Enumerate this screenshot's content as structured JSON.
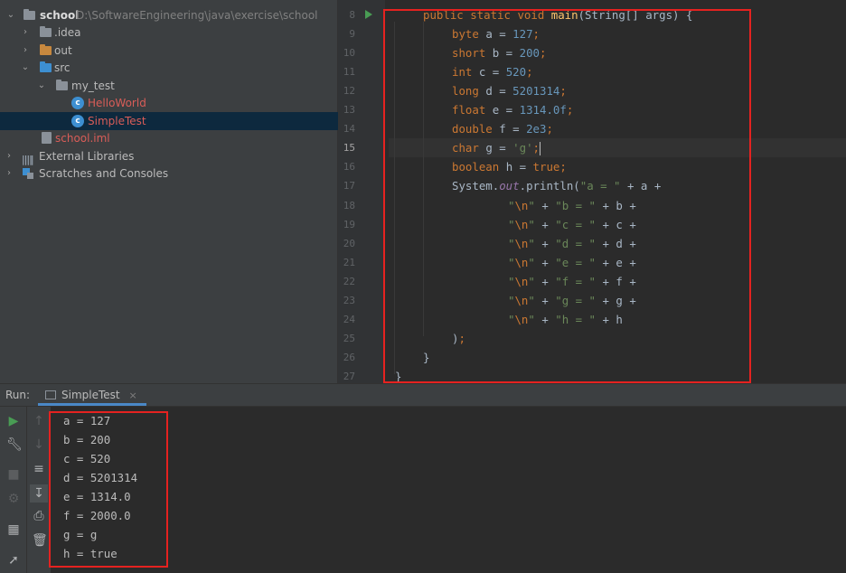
{
  "project_tree": {
    "root": {
      "name": "school",
      "path": "D:\\SoftwareEngineering\\java\\exercise\\school"
    },
    "items": [
      {
        "label": ".idea"
      },
      {
        "label": "out"
      },
      {
        "label": "src"
      },
      {
        "label": "my_test"
      },
      {
        "label": "HelloWorld"
      },
      {
        "label": "SimpleTest"
      },
      {
        "label": "school.iml"
      },
      {
        "label": "External Libraries"
      },
      {
        "label": "Scratches and Consoles"
      }
    ]
  },
  "editor": {
    "line_numbers": [
      "8",
      "9",
      "10",
      "11",
      "12",
      "13",
      "14",
      "15",
      "16",
      "17",
      "18",
      "19",
      "20",
      "21",
      "22",
      "23",
      "24",
      "25",
      "26",
      "27"
    ],
    "current_line": "15"
  },
  "code_lines": [
    [
      [
        "kw",
        "public "
      ],
      [
        "kw",
        "static "
      ],
      [
        "kw",
        "void "
      ],
      [
        "fn",
        "main"
      ],
      [
        "p",
        "(String[] args) {"
      ]
    ],
    [
      [
        "kw",
        "byte "
      ],
      [
        "p",
        "a = "
      ],
      [
        "num",
        "127"
      ],
      [
        "kw",
        ";"
      ]
    ],
    [
      [
        "kw",
        "short "
      ],
      [
        "p",
        "b = "
      ],
      [
        "num",
        "200"
      ],
      [
        "kw",
        ";"
      ]
    ],
    [
      [
        "kw",
        "int "
      ],
      [
        "p",
        "c = "
      ],
      [
        "num",
        "520"
      ],
      [
        "kw",
        ";"
      ]
    ],
    [
      [
        "kw",
        "long "
      ],
      [
        "p",
        "d = "
      ],
      [
        "num",
        "5201314"
      ],
      [
        "kw",
        ";"
      ]
    ],
    [
      [
        "kw",
        "float "
      ],
      [
        "p",
        "e = "
      ],
      [
        "num",
        "1314.0f"
      ],
      [
        "kw",
        ";"
      ]
    ],
    [
      [
        "kw",
        "double "
      ],
      [
        "p",
        "f = "
      ],
      [
        "num",
        "2e3"
      ],
      [
        "kw",
        ";"
      ]
    ],
    [
      [
        "kw",
        "char "
      ],
      [
        "p",
        "g = "
      ],
      [
        "str",
        "'g'"
      ],
      [
        "kw",
        ";"
      ]
    ],
    [
      [
        "kw",
        "boolean "
      ],
      [
        "p",
        "h = "
      ],
      [
        "kw",
        "true"
      ],
      [
        "kw",
        ";"
      ]
    ],
    [
      [
        "p",
        "System."
      ],
      [
        "sf",
        "out"
      ],
      [
        "p",
        ".println("
      ],
      [
        "str",
        "\"a = \""
      ],
      [
        "p",
        " + a +"
      ]
    ],
    [
      [
        "str",
        "\""
      ],
      [
        "esc",
        "\\n"
      ],
      [
        "str",
        "\""
      ],
      [
        "p",
        " + "
      ],
      [
        "str",
        "\"b = \""
      ],
      [
        "p",
        " + b +"
      ]
    ],
    [
      [
        "str",
        "\""
      ],
      [
        "esc",
        "\\n"
      ],
      [
        "str",
        "\""
      ],
      [
        "p",
        " + "
      ],
      [
        "str",
        "\"c = \""
      ],
      [
        "p",
        " + c +"
      ]
    ],
    [
      [
        "str",
        "\""
      ],
      [
        "esc",
        "\\n"
      ],
      [
        "str",
        "\""
      ],
      [
        "p",
        " + "
      ],
      [
        "str",
        "\"d = \""
      ],
      [
        "p",
        " + d +"
      ]
    ],
    [
      [
        "str",
        "\""
      ],
      [
        "esc",
        "\\n"
      ],
      [
        "str",
        "\""
      ],
      [
        "p",
        " + "
      ],
      [
        "str",
        "\"e = \""
      ],
      [
        "p",
        " + e +"
      ]
    ],
    [
      [
        "str",
        "\""
      ],
      [
        "esc",
        "\\n"
      ],
      [
        "str",
        "\""
      ],
      [
        "p",
        " + "
      ],
      [
        "str",
        "\"f = \""
      ],
      [
        "p",
        " + f +"
      ]
    ],
    [
      [
        "str",
        "\""
      ],
      [
        "esc",
        "\\n"
      ],
      [
        "str",
        "\""
      ],
      [
        "p",
        " + "
      ],
      [
        "str",
        "\"g = \""
      ],
      [
        "p",
        " + g +"
      ]
    ],
    [
      [
        "str",
        "\""
      ],
      [
        "esc",
        "\\n"
      ],
      [
        "str",
        "\""
      ],
      [
        "p",
        " + "
      ],
      [
        "str",
        "\"h = \""
      ],
      [
        "p",
        " + h"
      ]
    ],
    [
      [
        "p",
        ")"
      ],
      [
        "kw",
        ";"
      ]
    ],
    [
      [
        "p",
        "}"
      ]
    ],
    [
      [
        "p",
        "}"
      ]
    ]
  ],
  "run_panel": {
    "label": "Run:",
    "tab": "SimpleTest",
    "close_glyph": "×",
    "output": [
      "a = 127",
      "b = 200",
      "c = 520",
      "d = 5201314",
      "e = 1314.0",
      "f = 2000.0",
      "g = g",
      "h = true"
    ]
  },
  "colors": {
    "highlight_box": "#e52220",
    "keyword": "#cc7832",
    "number": "#6897bb",
    "string": "#6a8759",
    "method": "#ffc66d",
    "static_field": "#9876aa",
    "error_file": "#d95d58"
  },
  "icons": {
    "run": "run-icon",
    "settings": "wrench-icon",
    "stop": "stop-icon",
    "up": "up-arrow-icon",
    "down": "down-arrow-icon",
    "wrap": "soft-wrap-icon",
    "scroll": "scroll-to-end-icon",
    "print": "print-icon",
    "trash": "trash-icon",
    "layout": "layout-icon",
    "pin": "pin-icon"
  }
}
